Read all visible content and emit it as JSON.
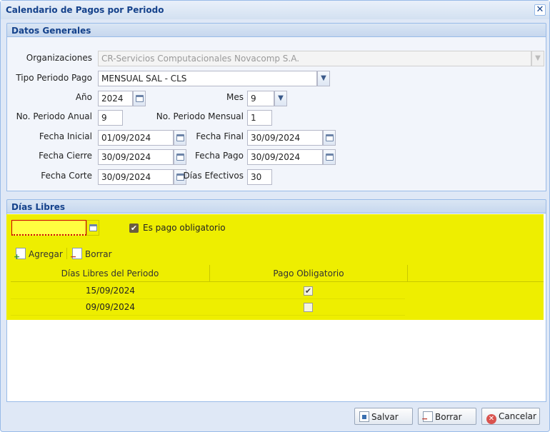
{
  "window": {
    "title": "Calendario de Pagos por Periodo",
    "close_glyph": "✕"
  },
  "datos_generales": {
    "header": "Datos Generales",
    "organizaciones": {
      "label": "Organizaciones",
      "value": "CR-Servicios Computacionales Novacomp S.A."
    },
    "tipo_periodo_pago": {
      "label": "Tipo Periodo Pago",
      "value": "MENSUAL SAL - CLS"
    },
    "anio": {
      "label": "Año",
      "value": "2024"
    },
    "mes": {
      "label": "Mes",
      "value": "9"
    },
    "no_periodo_anual": {
      "label": "No. Periodo Anual",
      "value": "9"
    },
    "no_periodo_mensual": {
      "label": "No. Periodo Mensual",
      "value": "1"
    },
    "fecha_inicial": {
      "label": "Fecha Inicial",
      "value": "01/09/2024"
    },
    "fecha_final": {
      "label": "Fecha Final",
      "value": "30/09/2024"
    },
    "fecha_cierre": {
      "label": "Fecha Cierre",
      "value": "30/09/2024"
    },
    "fecha_pago": {
      "label": "Fecha Pago",
      "value": "30/09/2024"
    },
    "fecha_corte": {
      "label": "Fecha Corte",
      "value": "30/09/2024"
    },
    "dias_efectivos": {
      "label": "Días Efectivos",
      "value": "30"
    }
  },
  "dias_libres": {
    "header": "Días Libres",
    "date_input_value": "",
    "es_pago_obligatorio": {
      "label": "Es pago obligatorio",
      "checked": true
    },
    "toolbar": {
      "agregar": "Agregar",
      "borrar": "Borrar"
    },
    "columns": [
      "Días Libres del Periodo",
      "Pago Obligatorio"
    ],
    "rows": [
      {
        "fecha": "15/09/2024",
        "pago_obligatorio": true
      },
      {
        "fecha": "09/09/2024",
        "pago_obligatorio": false
      }
    ]
  },
  "footer": {
    "salvar": "Salvar",
    "borrar": "Borrar",
    "cancelar": "Cancelar"
  },
  "colors": {
    "highlight": "#eeee00",
    "title_text": "#15428b",
    "window_bg": "#dfe8f6"
  }
}
